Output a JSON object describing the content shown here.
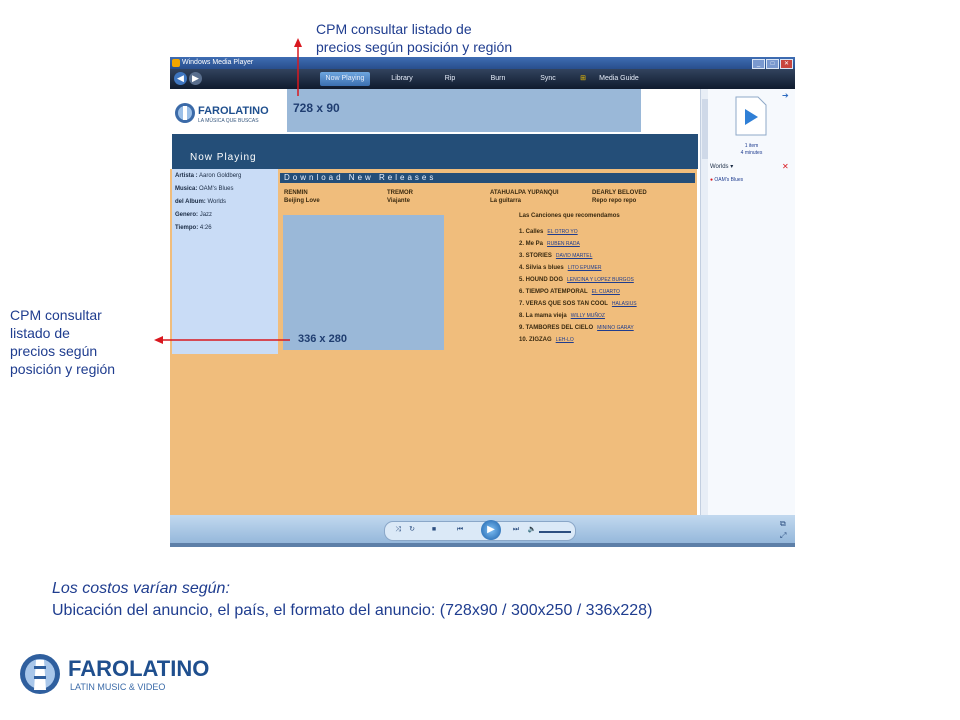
{
  "callouts": {
    "top": [
      "CPM consultar  listado de",
      "precios según posición y región"
    ],
    "left": [
      "CPM consultar",
      "listado de",
      "precios según",
      "posición y región"
    ]
  },
  "colors": {
    "callout_text": "#1f3d8f",
    "arrow": "#d9181f",
    "header_blue": "#244e78",
    "orange_bg": "#f0bd7c",
    "ad_slot": "#9ab8d8"
  },
  "wmp": {
    "title": "Windows Media Player",
    "window_buttons": [
      "_",
      "□",
      "✕"
    ],
    "tabs": [
      "Now Playing",
      "Library",
      "Rip",
      "Burn",
      "Sync",
      "Media Guide"
    ],
    "active_tab": "Now Playing",
    "site": {
      "logo_name": "FAROLATINO",
      "logo_tagline": "LA MÚSICA QUE BUSCAS",
      "banner_label": "728 x 90",
      "now_playing_label": "Now Playing",
      "track_info": [
        {
          "label": "Artista :",
          "value": "Aaron Goldberg"
        },
        {
          "label": "Musica:",
          "value": "OAM's Blues"
        },
        {
          "label": "del Album:",
          "value": "Worlds"
        },
        {
          "label": "Genero:",
          "value": "Jazz"
        },
        {
          "label": "Tiempo:",
          "value": "4:26"
        }
      ],
      "download_title": "Download New Releases",
      "releases": [
        {
          "artist": "RENMIN",
          "title": "Beijing Love"
        },
        {
          "artist": "TREMOR",
          "title": "Viajante"
        },
        {
          "artist": "ATAHUALPA YUPANQUI",
          "title": "La guitarra"
        },
        {
          "artist": "DEARLY BELOVED",
          "title": "Repo repo repo"
        }
      ],
      "box_label": "336 x 280",
      "songs_title": "Las Canciones que recomendamos",
      "songs": [
        {
          "title": "1. Calles",
          "artist": "EL OTRO YO"
        },
        {
          "title": "2. Me Pa",
          "artist": "RUBEN RADA"
        },
        {
          "title": "3. STORIES",
          "artist": "DAVID MARTEL"
        },
        {
          "title": "4. Silvia s blues",
          "artist": "LITO EPUMER"
        },
        {
          "title": "5. HOUND DOG",
          "artist": "LENCINA Y LOPEZ BURGOS"
        },
        {
          "title": "6. TIEMPO ATEMPORAL",
          "artist": "EL CUARTO"
        },
        {
          "title": "7. VERAS QUE SOS TAN COOL",
          "artist": "HALASIUS"
        },
        {
          "title": "8. La mama vieja",
          "artist": "WILLY MUÑOZ"
        },
        {
          "title": "9. TAMBORES DEL CIELO",
          "artist": "MININO GARAY"
        },
        {
          "title": "10. ZIGZAG",
          "artist": "LEH-LO"
        }
      ]
    },
    "playlist": {
      "items_count": "1 item",
      "duration": "4 minutes",
      "list_name": "Worlds",
      "item": "OAM's Blues"
    }
  },
  "caption": {
    "line1": "Los costos varían según:",
    "line2": "Ubicación del anuncio, el país, el formato del anuncio: (728x90 / 300x250 / 336x228)"
  },
  "brand": {
    "name": "FAROLATINO",
    "tagline": "LATIN MUSIC & VIDEO"
  }
}
